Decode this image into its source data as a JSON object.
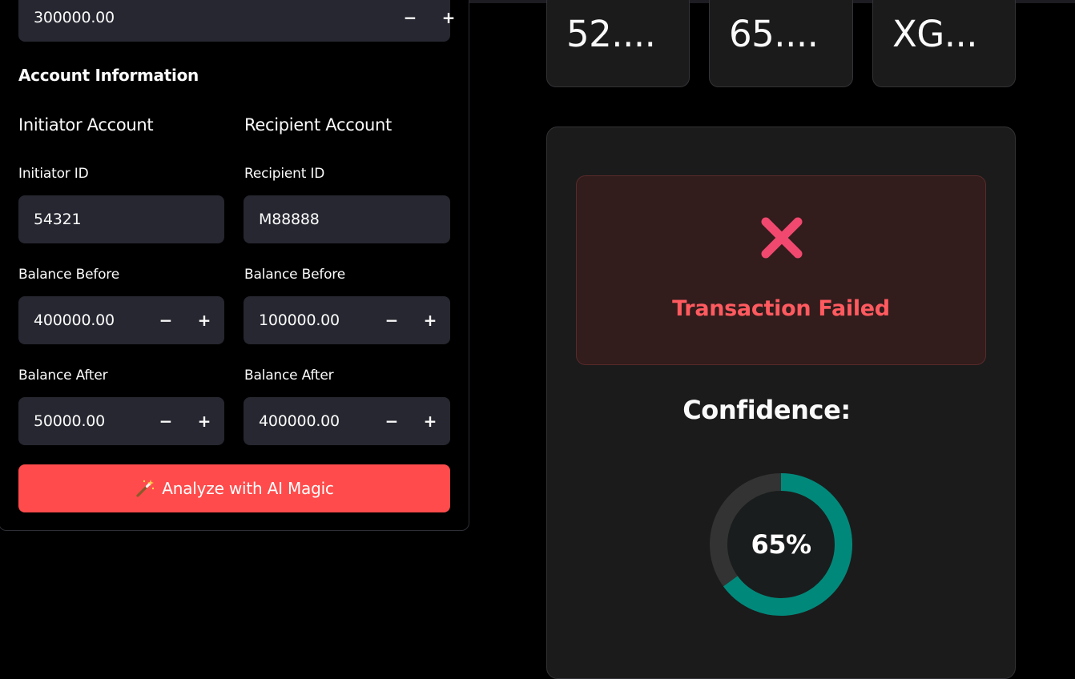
{
  "form": {
    "amount_value": "300000.00",
    "account_section_title": "Account Information",
    "initiator": {
      "column_title": "Initiator Account",
      "id_label": "Initiator ID",
      "id_value": "54321",
      "balance_before_label": "Balance Before",
      "balance_before_value": "400000.00",
      "balance_after_label": "Balance After",
      "balance_after_value": "50000.00"
    },
    "recipient": {
      "column_title": "Recipient Account",
      "id_label": "Recipient ID",
      "id_value": "M88888",
      "balance_before_label": "Balance Before",
      "balance_before_value": "100000.00",
      "balance_after_label": "Balance After",
      "balance_after_value": "400000.00"
    },
    "stepper_minus": "−",
    "stepper_plus": "+",
    "analyze_button_label": "Analyze with AI Magic",
    "analyze_button_icon": "magic-wand-icon"
  },
  "metrics": [
    {
      "value": "52...."
    },
    {
      "value": "65...."
    },
    {
      "value": "XG..."
    }
  ],
  "result": {
    "status_icon": "cross-icon",
    "status_text": "Transaction Failed",
    "confidence_label": "Confidence:",
    "confidence_value": 0.65,
    "confidence_text": "65%"
  },
  "colors": {
    "accent_red": "#ff4b4b",
    "fail_text": "#ff5a5f",
    "donut_fill": "#00897b",
    "donut_track": "#333333",
    "input_bg": "#262730",
    "panel_bg": "#1b1b1b"
  }
}
